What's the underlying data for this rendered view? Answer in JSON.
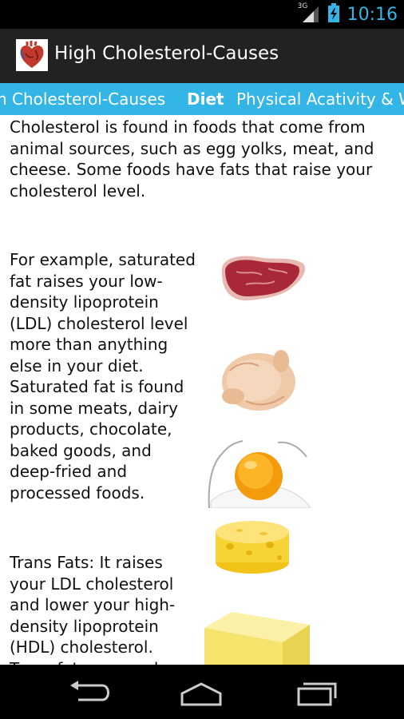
{
  "status_bar": {
    "network": "3G",
    "time": "10:16"
  },
  "action_bar": {
    "title": "High Cholesterol-Causes",
    "app_icon": "heart-icon"
  },
  "tabs": [
    {
      "label": "h Cholesterol-Causes",
      "active": false
    },
    {
      "label": "Diet",
      "active": true
    },
    {
      "label": "Physical Acativity & W",
      "active": false
    }
  ],
  "content": {
    "intro_lines": [
      "Cholesterol is found in foods that come from",
      "animal sources, such as egg yolks, meat, and",
      "cheese. Some foods have fats that raise your",
      "cholesterol level."
    ],
    "saturated_lines": [
      "For example, saturated",
      "fat raises your low-",
      "density lipoprotein",
      "(LDL) cholesterol level",
      "more than anything",
      "else in your diet.",
      "Saturated fat is found",
      "in some meats, dairy",
      "products, chocolate,",
      "baked goods, and",
      "deep-fried and",
      "processed foods."
    ],
    "trans_lines": [
      "Trans Fats: It raises",
      "your LDL cholesterol",
      "and lower your high-",
      "density lipoprotein",
      "(HDL) cholesterol.",
      "Trans fats are made"
    ]
  },
  "images": [
    "steak-image",
    "chicken-image",
    "egg-image",
    "cheese-image",
    "butter-image"
  ],
  "nav_bar": {
    "buttons": [
      "back-icon",
      "home-icon",
      "recent-apps-icon"
    ]
  },
  "colors": {
    "accent": "#33b5e5",
    "action_bar": "#222222",
    "status_bar": "#000000"
  }
}
